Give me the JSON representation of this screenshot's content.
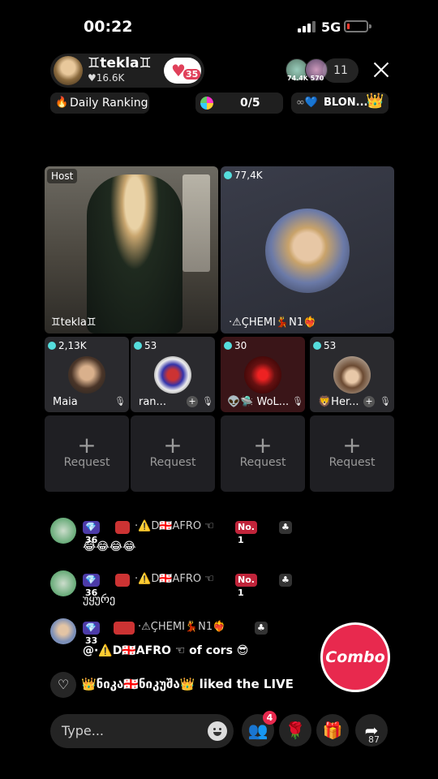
{
  "status_bar": {
    "time": "00:22",
    "network": "5G",
    "battery_level": 0.12
  },
  "host": {
    "name": "♊tekla♊",
    "likes": "♥16.6K",
    "follow_badge": "35"
  },
  "viewers": {
    "avatar_1_label": "74.4K",
    "avatar_2_label": "570",
    "count": "11"
  },
  "top_pills": {
    "ranking": "Daily Ranking",
    "goal": "0/5",
    "team": "BLON..."
  },
  "stage": {
    "host_tag": "Host",
    "host_name": "♊tekla♊",
    "guest_big": {
      "score": "77,4K",
      "name": "·⚠ÇHEMI💃N1❤️‍🔥"
    },
    "guests_small": [
      {
        "score": "2,13K",
        "name": "Maia"
      },
      {
        "score": "53",
        "name": "ran..."
      },
      {
        "score": "30",
        "name": "👽🛸 WoL..."
      },
      {
        "score": "53",
        "name": "🦁Her..."
      }
    ],
    "requests": [
      "Request",
      "Request",
      "Request",
      "Request"
    ]
  },
  "chat": [
    {
      "level": "💎36",
      "name": "·⚠️D🇬🇪AFRO ☜",
      "rank": "No. 1",
      "message": "😂😂😂😂"
    },
    {
      "level": "💎36",
      "name": "·⚠️D🇬🇪AFRO ☜",
      "rank": "No. 1",
      "message": "უყურე"
    },
    {
      "level": "💎33",
      "name": "·⚠ÇHEMI💃N1❤️‍🔥",
      "message": "@·⚠️D🇬🇪AFRO ☜ of cors 😎"
    }
  ],
  "like_event": "👑ნიკა🇬🇪ნიკუშა👑 liked the LIVE",
  "combo_label": "Combo",
  "bottom": {
    "input_placeholder": "Type...",
    "guests_badge": "4",
    "share_count": "87"
  },
  "colors": {
    "accent": "#e8294e",
    "background": "#000000"
  },
  "icons": [
    "signal-icon",
    "battery-icon",
    "close-icon",
    "fire-icon",
    "heart-icon",
    "microphone-off-icon",
    "emoji-icon",
    "rose-icon",
    "gift-icon",
    "share-icon",
    "guests-icon"
  ]
}
